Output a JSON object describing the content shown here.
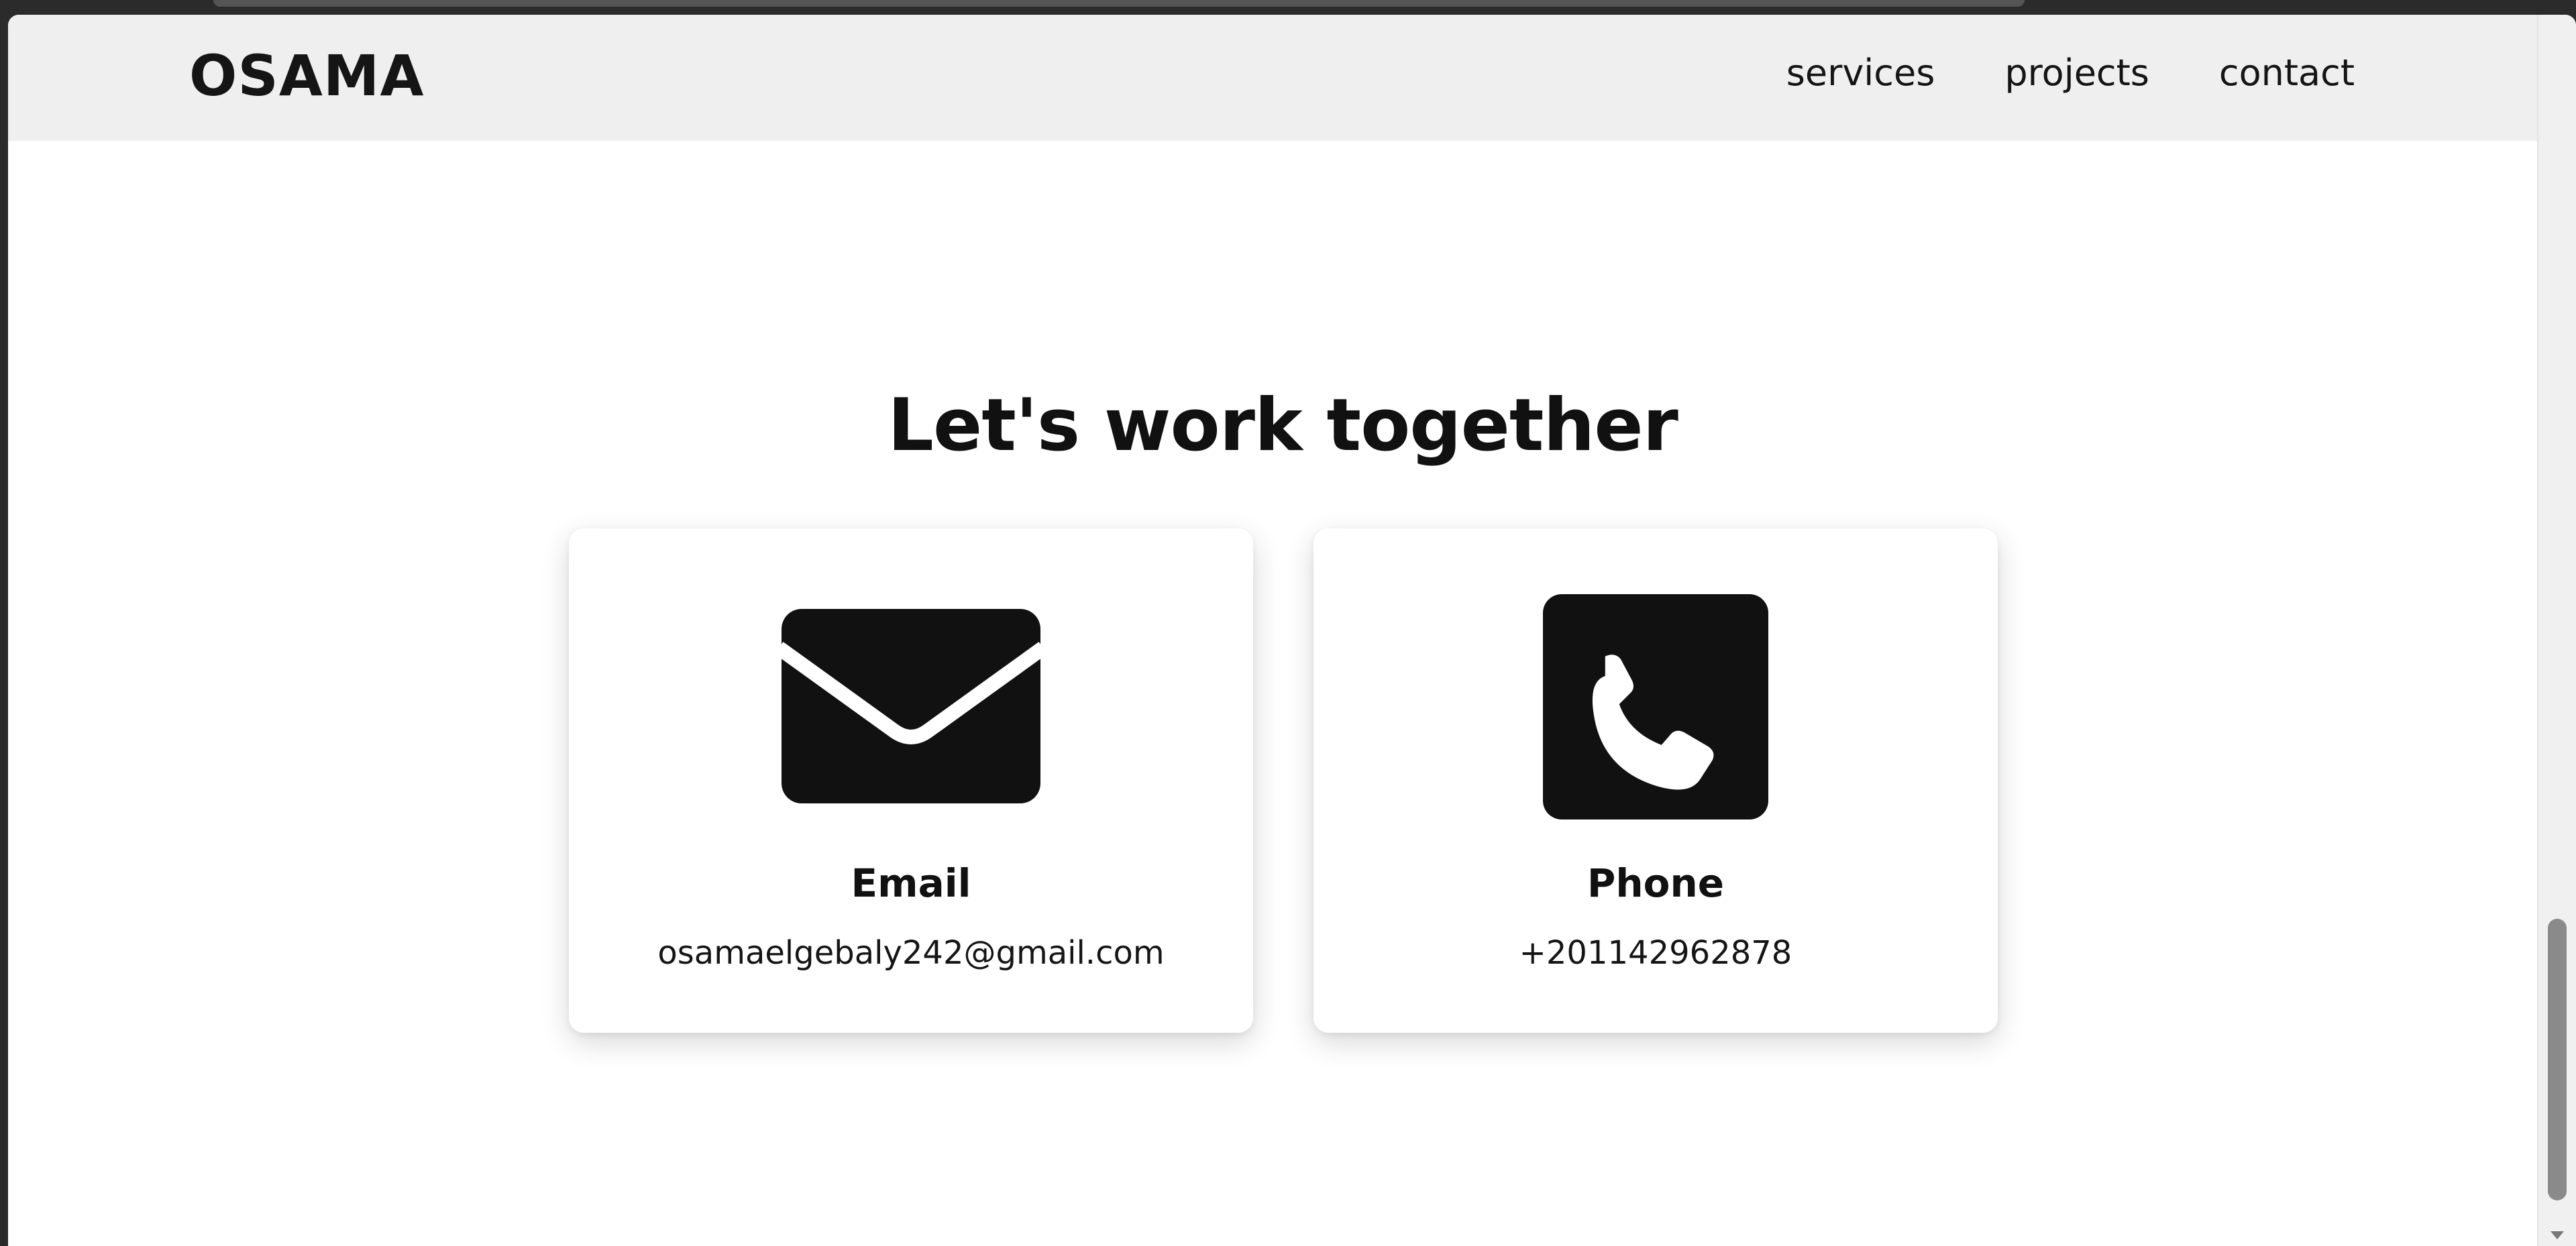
{
  "header": {
    "brand": "OSAMA",
    "nav": [
      {
        "label": "services"
      },
      {
        "label": "projects"
      },
      {
        "label": "contact"
      }
    ]
  },
  "contact": {
    "title": "Let's work together",
    "cards": [
      {
        "icon": "envelope-icon",
        "label": "Email",
        "value": "osamaelgebaly242@gmail.com"
      },
      {
        "icon": "phone-icon",
        "label": "Phone",
        "value": "+201142962878"
      }
    ]
  },
  "colors": {
    "header_bg": "#efefef",
    "text": "#111111",
    "icon_fill": "#111111",
    "page_bg": "#ffffff"
  }
}
